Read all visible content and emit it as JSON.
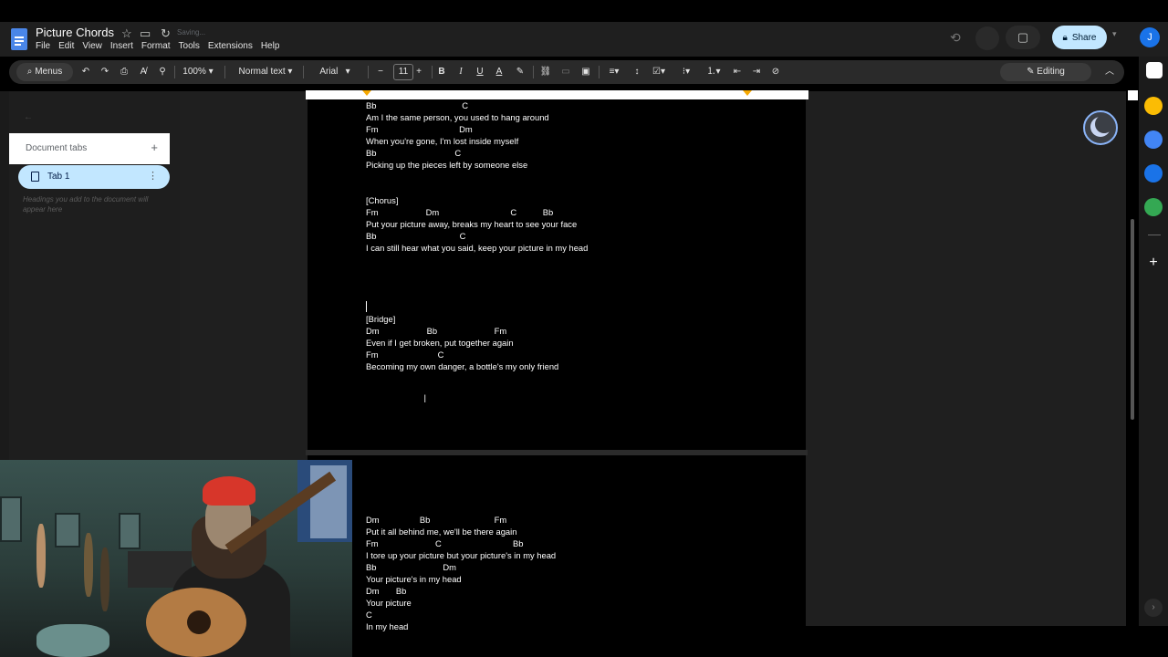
{
  "doc": {
    "title": "Picture Chords",
    "saving": "Saving...",
    "menu": [
      "File",
      "Edit",
      "View",
      "Insert",
      "Format",
      "Tools",
      "Extensions",
      "Help"
    ]
  },
  "header": {
    "share_label": "Share",
    "avatar_initial": "J"
  },
  "toolbar": {
    "menus_label": "Menus",
    "zoom": "100%",
    "style": "Normal text",
    "font": "Arial",
    "font_size": "11",
    "editing_label": "Editing"
  },
  "sidebar": {
    "document_tabs_label": "Document tabs",
    "tab_label": "Tab 1",
    "hint": "Headings you add to the document will appear here"
  },
  "page1_lines": [
    "Bb                                    C",
    "Am I the same person, you used to hang around",
    "Fm                                  Dm",
    "When you're gone, I'm lost inside myself",
    "Bb                                 C",
    "Picking up the pieces left by someone else",
    "",
    "",
    "[Chorus]",
    "Fm                    Dm                              C           Bb",
    "Put your picture away, breaks my heart to see your face",
    "Bb                                   C",
    "I can still hear what you said, keep your picture in my head",
    "",
    "",
    "",
    "",
    "",
    "[Bridge]",
    "Dm                    Bb                        Fm",
    "Even if I get broken, put together again",
    "Fm                         C",
    "Becoming my own danger, a bottle's my only friend"
  ],
  "page2_lines": [
    "Dm                 Bb                           Fm",
    "Put it all behind me, we'll be there again",
    "Fm                        C                              Bb",
    "I tore up your picture but your picture's in my head",
    "Bb                            Dm",
    "Your picture's in my head",
    "Dm       Bb",
    "Your picture",
    "C",
    "In my head"
  ],
  "colors": {
    "accent": "#c2e7ff",
    "doc_icon": "#4a86e8",
    "ruler_marker": "#f6a800"
  },
  "icons": [
    "docs-icon",
    "star-icon",
    "folder-icon",
    "sync-icon",
    "history-icon",
    "meet-icon",
    "lock-icon",
    "undo-icon",
    "redo-icon",
    "print-icon",
    "spellcheck-icon",
    "paint-format-icon",
    "bold-icon",
    "italic-icon",
    "underline-icon",
    "text-color-icon",
    "highlight-icon",
    "link-icon",
    "comment-icon",
    "image-icon",
    "align-icon",
    "line-spacing-icon",
    "checklist-icon",
    "bullet-list-icon",
    "numbered-list-icon",
    "indent-decrease-icon",
    "indent-increase-icon",
    "clear-format-icon",
    "pencil-icon",
    "chevron-up-icon",
    "dark-mode-icon",
    "calendar-icon",
    "keep-icon",
    "tasks-icon",
    "contacts-icon",
    "maps-icon",
    "plus-icon"
  ]
}
